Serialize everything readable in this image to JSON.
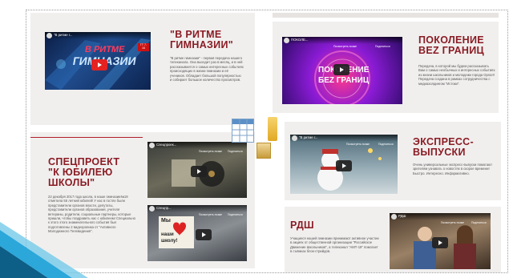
{
  "block1": {
    "title_line1": "\"В РИТМЕ",
    "title_line2": "ГИМНАЗИИ\"",
    "description": "\"В ритме гимназии\" - первая передача нашего телеканала. Она выходит раз в месяц, и в ней рассказывается о самых интересных событиях происходящих в жизни гимназии и её учеников. Обладает большой популярностью и собирает большое количество просмотров.",
    "video": {
      "title": "\"В ритме г...",
      "overlay_line1": "В РИТМЕ",
      "overlay_line2": "ГИМНАЗИИ",
      "badge": "ГТ 7-16"
    }
  },
  "block2": {
    "title_line1": "ПОКОЛЕНИЕ",
    "title_line2": "BEZ ГРАНИЦ",
    "description": "Передача, в которой мы будем рассказывать Вам о самых необычных и интересных событиях из жизни школьников и молодежи города Орла!!! Передача создана в рамках сотрудничества с медиахолдингом \"Истоки\".",
    "video": {
      "title": "ПОКОЛЕ...",
      "watch_later": "Посмотреть позже",
      "share": "Поделиться",
      "overlay_line1": "ПОКОЛЕНИЕ",
      "overlay_line2": "БЕZ ГРАНИЦ"
    }
  },
  "block3": {
    "title_line1": "СПЕЦПРОЕКТ",
    "title_line2": "\"К ЮБИЛЕЮ",
    "title_line3": "ШКОЛЫ\"",
    "description": "22 декабря 2017 года школа, в наше гимназии№19 отметила 55 летний юбилей! У нас в гостях были представители органов власти, депутаты, представители органов образования, учителя ветераны, родители, социальные партнеры, которые пришли, чтобы поздравить нас с юбилеем! Специально к этого этого знаменательного события был подготовлены 2 видеоролика от \"Активного Молодежного Телевидения\".",
    "video1": {
      "title": "Спецпроек...",
      "watch_later": "Посмотреть позже",
      "share": "Поделиться"
    },
    "video2": {
      "title": "Спецпр...",
      "watch_later": "Посмотреть позже",
      "share": "Поделиться",
      "sign_line1": "Мы",
      "sign_line2": "наши",
      "sign_line3": "школу!"
    }
  },
  "block4": {
    "title_line1": "ЭКСПРЕСС-",
    "title_line2": "ВЫПУСКИ",
    "description": "Очень универсальные экспресс-выпуски помогают зрителям узнавать о новостях в скорое времени! Быстро. Интересно. Информативно.",
    "video": {
      "title": "\"В ритме г...",
      "watch_later": "Посмотреть позже",
      "share": "Поделиться"
    }
  },
  "block5": {
    "title": "РДШ",
    "description": "Учащиеся нашей гимназии принимают активное участие в акциях от общественной организации \"Российское Движение Школьников\", а телеканал \"АМТ-19\" помогает в съёмках блок-стрийдов.",
    "video": {
      "title": "РДШ",
      "watch_later": "Посмотреть позже",
      "share": "Поделиться"
    }
  },
  "colors": {
    "title": "#8a1c24",
    "accent": "#1d9fd0",
    "panel": "#f1efee"
  }
}
